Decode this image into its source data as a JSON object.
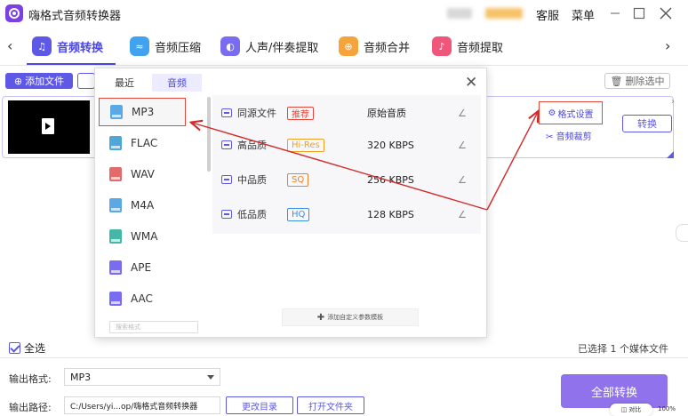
{
  "app": {
    "title": "嗨格式音频转换器",
    "service": "客服",
    "menu": "菜单"
  },
  "tabs": [
    {
      "label": "音频转换",
      "icon": "headphones-icon",
      "color": "#5e58e6"
    },
    {
      "label": "音频压缩",
      "icon": "compress-icon",
      "color": "#41a3f0"
    },
    {
      "label": "人声/伴奏提取",
      "icon": "vocal-icon",
      "color": "#7a6cf0"
    },
    {
      "label": "音频合并",
      "icon": "merge-icon",
      "color": "#f7a33b"
    },
    {
      "label": "音频提取",
      "icon": "mic-icon",
      "color": "#f0567a"
    }
  ],
  "toolbar": {
    "add_file": "添加文件",
    "delete_selected": "删除选中"
  },
  "file_card": {
    "format_settings": "格式设置",
    "audio_cut": "音频裁剪",
    "convert": "转换"
  },
  "popup": {
    "tab_recent": "最近",
    "tab_audio": "音频",
    "formats": [
      "MP3",
      "FLAC",
      "WAV",
      "M4A",
      "WMA",
      "APE",
      "AAC"
    ],
    "selected_format": "MP3",
    "search_placeholder": "搜索格式",
    "qualities": [
      {
        "name": "同源文件",
        "badge": "推荐",
        "rate": "原始音质",
        "badge_color": "#e4473c"
      },
      {
        "name": "高品质",
        "badge": "Hi-Res",
        "rate": "320 KBPS",
        "badge_color": "#f0a020"
      },
      {
        "name": "中品质",
        "badge": "SQ",
        "rate": "256 KBPS",
        "badge_color": "#f08020"
      },
      {
        "name": "低品质",
        "badge": "HQ",
        "rate": "128 KBPS",
        "badge_color": "#3a8fe8"
      }
    ],
    "add_template": "添加自定义参数模板"
  },
  "bottom": {
    "select_all": "全选",
    "selected_count": "已选择 1 个媒体文件",
    "output_format_label": "输出格式:",
    "output_format_value": "MP3",
    "output_path_label": "输出路径:",
    "output_path_value": "C:/Users/yi...op/嗨格式音频转换器",
    "change_dir": "更改目录",
    "open_folder": "打开文件夹",
    "convert_all": "全部转换",
    "compare": "对比",
    "zoom": "100%"
  },
  "colors": {
    "accent": "#5e58e6",
    "highlight_box": "#e4473c",
    "annotation_arrow": "#d22a2a"
  }
}
